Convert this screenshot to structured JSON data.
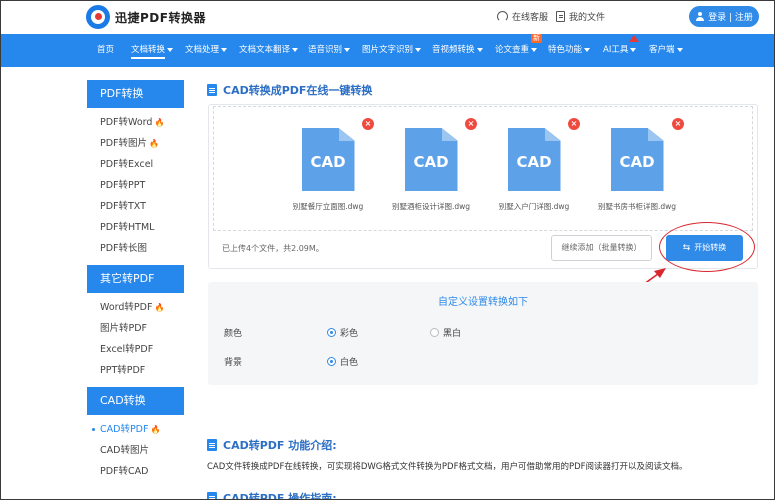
{
  "header": {
    "brand": "迅捷PDF转换器",
    "service_link": "在线客服",
    "docs_link": "我的文件",
    "login_label": "登录 | 注册"
  },
  "nav": {
    "items": [
      {
        "label": "首页",
        "caret": false
      },
      {
        "label": "文档转换",
        "caret": true
      },
      {
        "label": "文档处理",
        "caret": true
      },
      {
        "label": "文档文本翻译",
        "caret": true
      },
      {
        "label": "语音识别",
        "caret": true
      },
      {
        "label": "图片文字识别",
        "caret": true
      },
      {
        "label": "音视频转换",
        "caret": true
      },
      {
        "label": "论文查重",
        "caret": true
      },
      {
        "label": "特色功能",
        "caret": true
      },
      {
        "label": "AI工具",
        "caret": true
      },
      {
        "label": "客户端",
        "caret": true
      }
    ],
    "new_badge": "新"
  },
  "sidebar": {
    "groups": [
      {
        "title": "PDF转换",
        "items": [
          "PDF转Word",
          "PDF转图片",
          "PDF转Excel",
          "PDF转PPT",
          "PDF转TXT",
          "PDF转HTML",
          "PDF转长图"
        ]
      },
      {
        "title": "其它转PDF",
        "items": [
          "Word转PDF",
          "图片转PDF",
          "Excel转PDF",
          "PPT转PDF"
        ]
      },
      {
        "title": "CAD转换",
        "items": [
          "CAD转PDF",
          "CAD转图片",
          "PDF转CAD"
        ]
      }
    ]
  },
  "main": {
    "title": "CAD转换成PDF在线一键转换",
    "files": [
      {
        "ext": "CAD",
        "name": "别墅餐厅立面图.dwg"
      },
      {
        "ext": "CAD",
        "name": "别墅酒柜设计详图.dwg"
      },
      {
        "ext": "CAD",
        "name": "别墅入户门详图.dwg"
      },
      {
        "ext": "CAD",
        "name": "别墅书房书柜详图.dwg"
      }
    ],
    "upload_info": "已上传4个文件，共2.09M。",
    "continue_button": "继续添加（批量转换）",
    "start_button": "开始转换",
    "settings": {
      "title": "自定义设置转换如下",
      "color_label": "颜色",
      "color_options": [
        "彩色",
        "黑白"
      ],
      "color_selected": "彩色",
      "bg_label": "背景",
      "bg_options": [
        "白色"
      ],
      "bg_selected": "白色"
    },
    "intro_title": "CAD转PDF 功能介绍:",
    "intro_text": "CAD文件转换成PDF在线转换，可实现将DWG格式文件转换为PDF格式文档，用户可借助常用的PDF阅读器打开以及阅读文档。",
    "guide_title": "CAD转PDF 操作指南:"
  },
  "colors": {
    "primary": "#2687ec",
    "accent": "#2f8ae8",
    "danger": "#d9272e",
    "hot": "#ff6a2b"
  }
}
